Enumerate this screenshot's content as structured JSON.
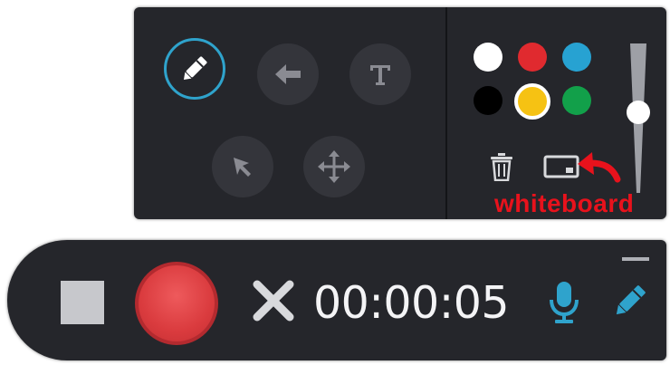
{
  "palette": {
    "tools": [
      {
        "name": "pen-tool",
        "icon": "pencil-icon",
        "active": true
      },
      {
        "name": "arrow-tool",
        "icon": "arrow-left-icon",
        "active": false
      },
      {
        "name": "text-tool",
        "icon": "text-T-icon",
        "active": false
      },
      {
        "name": "select-tool",
        "icon": "cursor-pointer-icon",
        "active": false
      },
      {
        "name": "move-tool",
        "icon": "move-arrows-icon",
        "active": false
      }
    ],
    "colors": [
      {
        "name": "white",
        "hex": "#ffffff",
        "selected": false
      },
      {
        "name": "red",
        "hex": "#e02a2f",
        "selected": false
      },
      {
        "name": "blue",
        "hex": "#27a2d2",
        "selected": false
      },
      {
        "name": "black",
        "hex": "#000000",
        "selected": false
      },
      {
        "name": "yellow",
        "hex": "#f6c213",
        "selected": true
      },
      {
        "name": "green",
        "hex": "#12a04a",
        "selected": false
      }
    ],
    "stroke_size_fraction": 0.5,
    "annotation": {
      "label": "whiteboard",
      "color": "#e8121c"
    }
  },
  "recorder": {
    "timer": "00:00:05",
    "icons": {
      "stop": "stop-square-icon",
      "record": "record-circle-icon",
      "cancel": "close-x-icon",
      "mic": "microphone-icon",
      "draw": "pencil-icon",
      "minimize": "minimize-dash-icon"
    },
    "accent": "#2fa3cc"
  }
}
